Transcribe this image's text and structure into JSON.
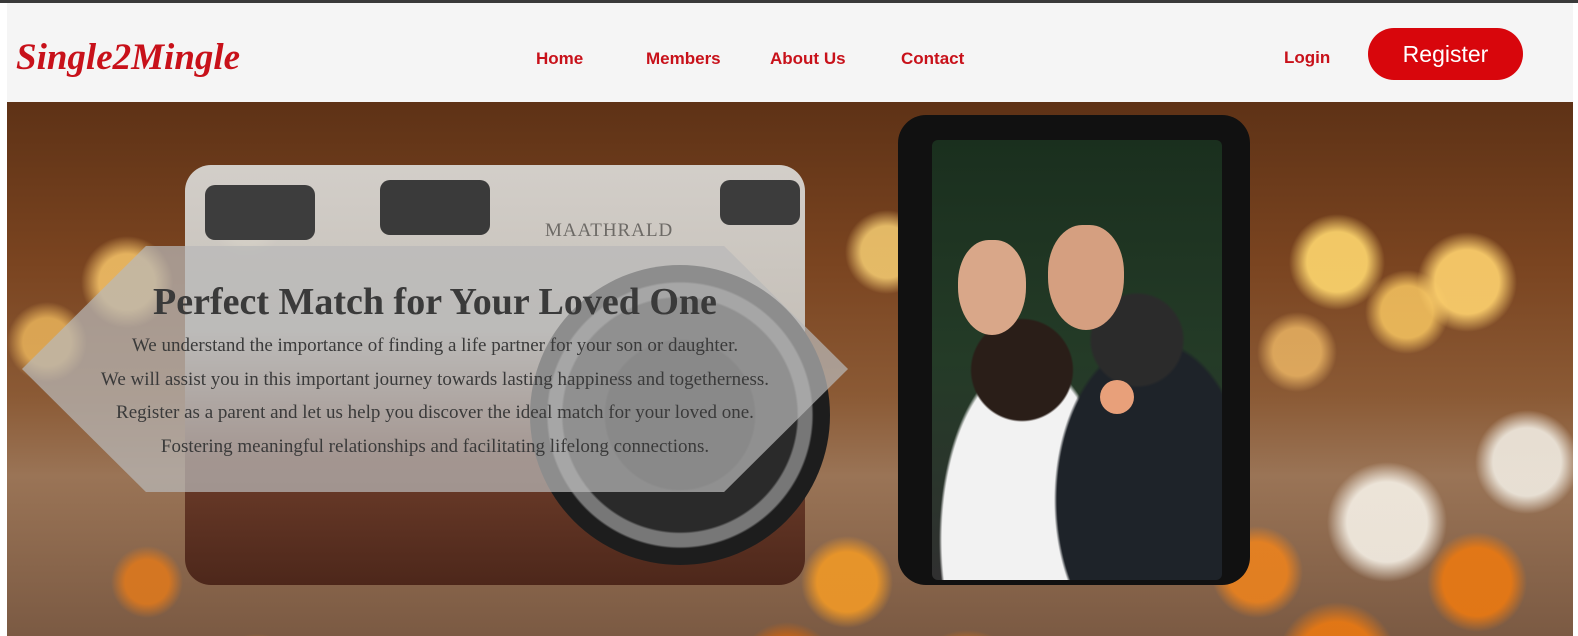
{
  "brand": {
    "logo_text": "Single2Mingle",
    "color": "#c8111a"
  },
  "nav": {
    "items": [
      {
        "label": "Home"
      },
      {
        "label": "Members"
      },
      {
        "label": "About Us"
      },
      {
        "label": "Contact"
      }
    ],
    "login_label": "Login",
    "register_label": "Register",
    "register_color": "#d8060c"
  },
  "hero": {
    "title": "Perfect Match for Your Loved One",
    "lines": [
      "We understand the importance of finding a life partner for your son or daughter.",
      "We will assist you in this important journey towards lasting happiness and togetherness.",
      "Register as a parent and let us help you discover the ideal match for your loved one.",
      "Fostering meaningful relationships and facilitating lifelong connections."
    ],
    "camera_brand": "MAATHRALD"
  }
}
